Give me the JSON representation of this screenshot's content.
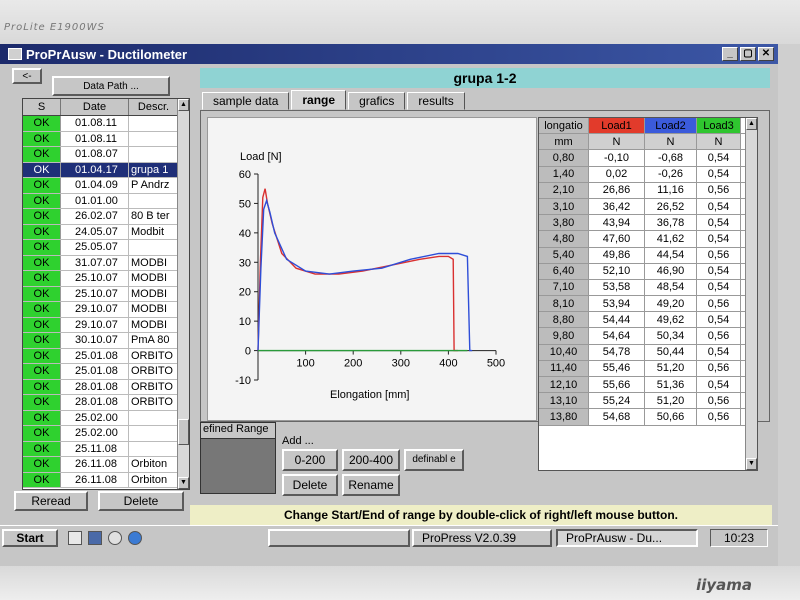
{
  "monitor": {
    "model": "ProLite E1900WS",
    "brand": "iiyama"
  },
  "window": {
    "title": "ProPrAusw - Ductilometer",
    "min": "_",
    "max": "▢",
    "close": "✕"
  },
  "back_button": "<-",
  "data_path_button": "Data Path ...",
  "list": {
    "headers": [
      "S",
      "Date",
      "Descr."
    ],
    "rows": [
      {
        "s": "OK",
        "date": "01.08.11",
        "descr": ""
      },
      {
        "s": "OK",
        "date": "01.08.11",
        "descr": ""
      },
      {
        "s": "OK",
        "date": "01.08.07",
        "descr": ""
      },
      {
        "s": "OK",
        "date": "01.04.17",
        "descr": "grupa 1"
      },
      {
        "s": "OK",
        "date": "01.04.09",
        "descr": "P Andrz"
      },
      {
        "s": "OK",
        "date": "01.01.00",
        "descr": ""
      },
      {
        "s": "OK",
        "date": "26.02.07",
        "descr": "80 B ter"
      },
      {
        "s": "OK",
        "date": "24.05.07",
        "descr": "Modbit"
      },
      {
        "s": "OK",
        "date": "25.05.07",
        "descr": ""
      },
      {
        "s": "OK",
        "date": "31.07.07",
        "descr": "MODBI"
      },
      {
        "s": "OK",
        "date": "25.10.07",
        "descr": "MODBI"
      },
      {
        "s": "OK",
        "date": "25.10.07",
        "descr": "MODBI"
      },
      {
        "s": "OK",
        "date": "29.10.07",
        "descr": "MODBI"
      },
      {
        "s": "OK",
        "date": "29.10.07",
        "descr": "MODBI"
      },
      {
        "s": "OK",
        "date": "30.10.07",
        "descr": "PmA 80"
      },
      {
        "s": "OK",
        "date": "25.01.08",
        "descr": "ORBITO"
      },
      {
        "s": "OK",
        "date": "25.01.08",
        "descr": "ORBITO"
      },
      {
        "s": "OK",
        "date": "28.01.08",
        "descr": "ORBITO"
      },
      {
        "s": "OK",
        "date": "28.01.08",
        "descr": "ORBITO"
      },
      {
        "s": "OK",
        "date": "25.02.00",
        "descr": ""
      },
      {
        "s": "OK",
        "date": "25.02.00",
        "descr": ""
      },
      {
        "s": "OK",
        "date": "25.11.08",
        "descr": ""
      },
      {
        "s": "OK",
        "date": "26.11.08",
        "descr": "Orbiton"
      },
      {
        "s": "OK",
        "date": "26.11.08",
        "descr": "Orbiton"
      }
    ],
    "selected_index": 3
  },
  "reread_button": "Reread",
  "delete_button": "Delete",
  "group_title": "grupa 1-2",
  "tabs": [
    "sample data",
    "range",
    "grafics",
    "results"
  ],
  "active_tab": "range",
  "chart_data": {
    "type": "line",
    "title": "",
    "xlabel": "Elongation [mm]",
    "ylabel": "Load [N]",
    "xlim": [
      0,
      500
    ],
    "ylim": [
      -10,
      60
    ],
    "xticks": [
      100,
      200,
      300,
      400,
      500
    ],
    "yticks": [
      -10,
      0,
      10,
      20,
      30,
      40,
      50,
      60
    ],
    "series": [
      {
        "color": "#d93030",
        "points": [
          [
            0,
            0
          ],
          [
            5,
            30
          ],
          [
            10,
            52
          ],
          [
            15,
            55
          ],
          [
            20,
            50
          ],
          [
            30,
            43
          ],
          [
            50,
            33
          ],
          [
            80,
            28
          ],
          [
            120,
            26
          ],
          [
            170,
            26
          ],
          [
            220,
            27
          ],
          [
            280,
            29
          ],
          [
            340,
            31
          ],
          [
            380,
            32
          ],
          [
            400,
            32
          ],
          [
            410,
            31
          ],
          [
            412,
            0
          ],
          [
            420,
            0
          ]
        ]
      },
      {
        "color": "#2e4ed8",
        "points": [
          [
            0,
            0
          ],
          [
            6,
            28
          ],
          [
            12,
            48
          ],
          [
            18,
            51
          ],
          [
            25,
            47
          ],
          [
            35,
            40
          ],
          [
            60,
            31
          ],
          [
            100,
            27
          ],
          [
            150,
            26
          ],
          [
            200,
            27
          ],
          [
            260,
            28
          ],
          [
            320,
            31
          ],
          [
            380,
            33
          ],
          [
            420,
            33
          ],
          [
            440,
            32
          ],
          [
            445,
            0
          ],
          [
            450,
            0
          ]
        ]
      },
      {
        "color": "#2a9a3a",
        "points": [
          [
            0,
            0
          ],
          [
            440,
            0
          ]
        ]
      }
    ]
  },
  "results_table": {
    "headers": [
      {
        "label": "longatio",
        "color": "#bcbcbc"
      },
      {
        "label": "Load1",
        "color": "#e23b2b"
      },
      {
        "label": "Load2",
        "color": "#3b5bdb"
      },
      {
        "label": "Load3",
        "color": "#2fc52f"
      }
    ],
    "units": [
      "mm",
      "N",
      "N",
      "N"
    ],
    "rows": [
      [
        "0,80",
        "-0,10",
        "-0,68",
        "0,54"
      ],
      [
        "1,40",
        "0,02",
        "-0,26",
        "0,54"
      ],
      [
        "2,10",
        "26,86",
        "11,16",
        "0,56"
      ],
      [
        "3,10",
        "36,42",
        "26,52",
        "0,54"
      ],
      [
        "3,80",
        "43,94",
        "36,78",
        "0,54"
      ],
      [
        "4,80",
        "47,60",
        "41,62",
        "0,54"
      ],
      [
        "5,40",
        "49,86",
        "44,54",
        "0,56"
      ],
      [
        "6,40",
        "52,10",
        "46,90",
        "0,54"
      ],
      [
        "7,10",
        "53,58",
        "48,54",
        "0,54"
      ],
      [
        "8,10",
        "53,94",
        "49,20",
        "0,56"
      ],
      [
        "8,80",
        "54,44",
        "49,62",
        "0,54"
      ],
      [
        "9,80",
        "54,64",
        "50,34",
        "0,56"
      ],
      [
        "10,40",
        "54,78",
        "50,44",
        "0,54"
      ],
      [
        "11,40",
        "55,46",
        "51,20",
        "0,56"
      ],
      [
        "12,10",
        "55,66",
        "51,36",
        "0,54"
      ],
      [
        "13,10",
        "55,24",
        "51,20",
        "0,56"
      ],
      [
        "13,80",
        "54,68",
        "50,66",
        "0,56"
      ]
    ]
  },
  "defined_range_label": "efined Range",
  "add_label": "Add ...",
  "range_buttons": [
    "0-200",
    "200-400",
    "definabl e"
  ],
  "delete_range_button": "Delete",
  "rename_button": "Rename",
  "status_message": "Change Start/End of range by double-click of right/left mouse button.",
  "taskbar": {
    "start": "Start",
    "tasks": [
      "ProPress  V2.0.39",
      "ProPrAusw - Du..."
    ],
    "clock": "10:23"
  }
}
